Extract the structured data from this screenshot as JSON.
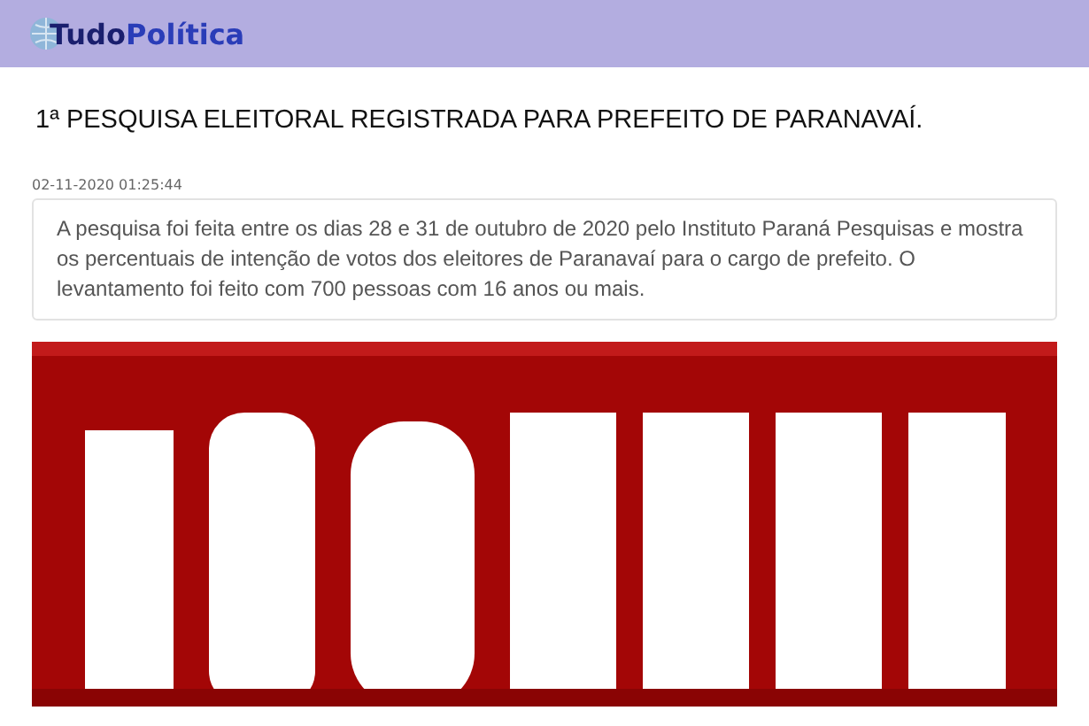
{
  "header": {
    "logo": [
      "Tudo",
      "Política"
    ]
  },
  "article": {
    "title": "1ª PESQUISA ELEITORAL REGISTRADA PARA PREFEITO DE PARANAVAÍ.",
    "timestamp": "02-11-2020 01:25:44",
    "summary": "A pesquisa foi feita entre os dias 28 e 31 de outubro de 2020 pelo Instituto Paraná Pesquisas e mostra os percentuais de intenção de votos dos eleitores de Paranavaí para o cargo de prefeito. O levantamento foi feito com 700 pessoas com 16 anos ou mais."
  }
}
